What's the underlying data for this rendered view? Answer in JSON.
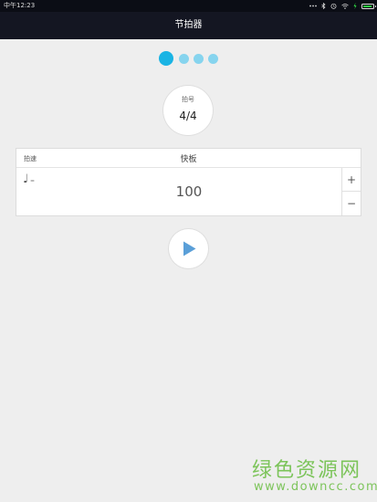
{
  "statusbar": {
    "time": "中午12:23",
    "icons": [
      "more-icon",
      "bluetooth-icon",
      "alarm-icon",
      "wifi-icon",
      "charging-icon",
      "battery-icon"
    ],
    "battery_color": "#2ecc40"
  },
  "titlebar": {
    "title": "节拍器"
  },
  "pager": {
    "page_count": 4,
    "active_index": 0,
    "active_color": "#1ab4e4",
    "inactive_color": "#86d4ee"
  },
  "time_signature": {
    "label": "拍号",
    "value": "4/4"
  },
  "tempo": {
    "label": "拍速",
    "name": "快板",
    "note_symbol": "♩",
    "equals": "=",
    "value": "100",
    "increment_label": "+",
    "decrement_label": "−"
  },
  "play_button": {
    "icon": "play-icon",
    "color": "#5a9fd8"
  },
  "watermark": {
    "title": "绿色资源网",
    "url": "www.downcc.com",
    "color": "#7cc45a"
  }
}
